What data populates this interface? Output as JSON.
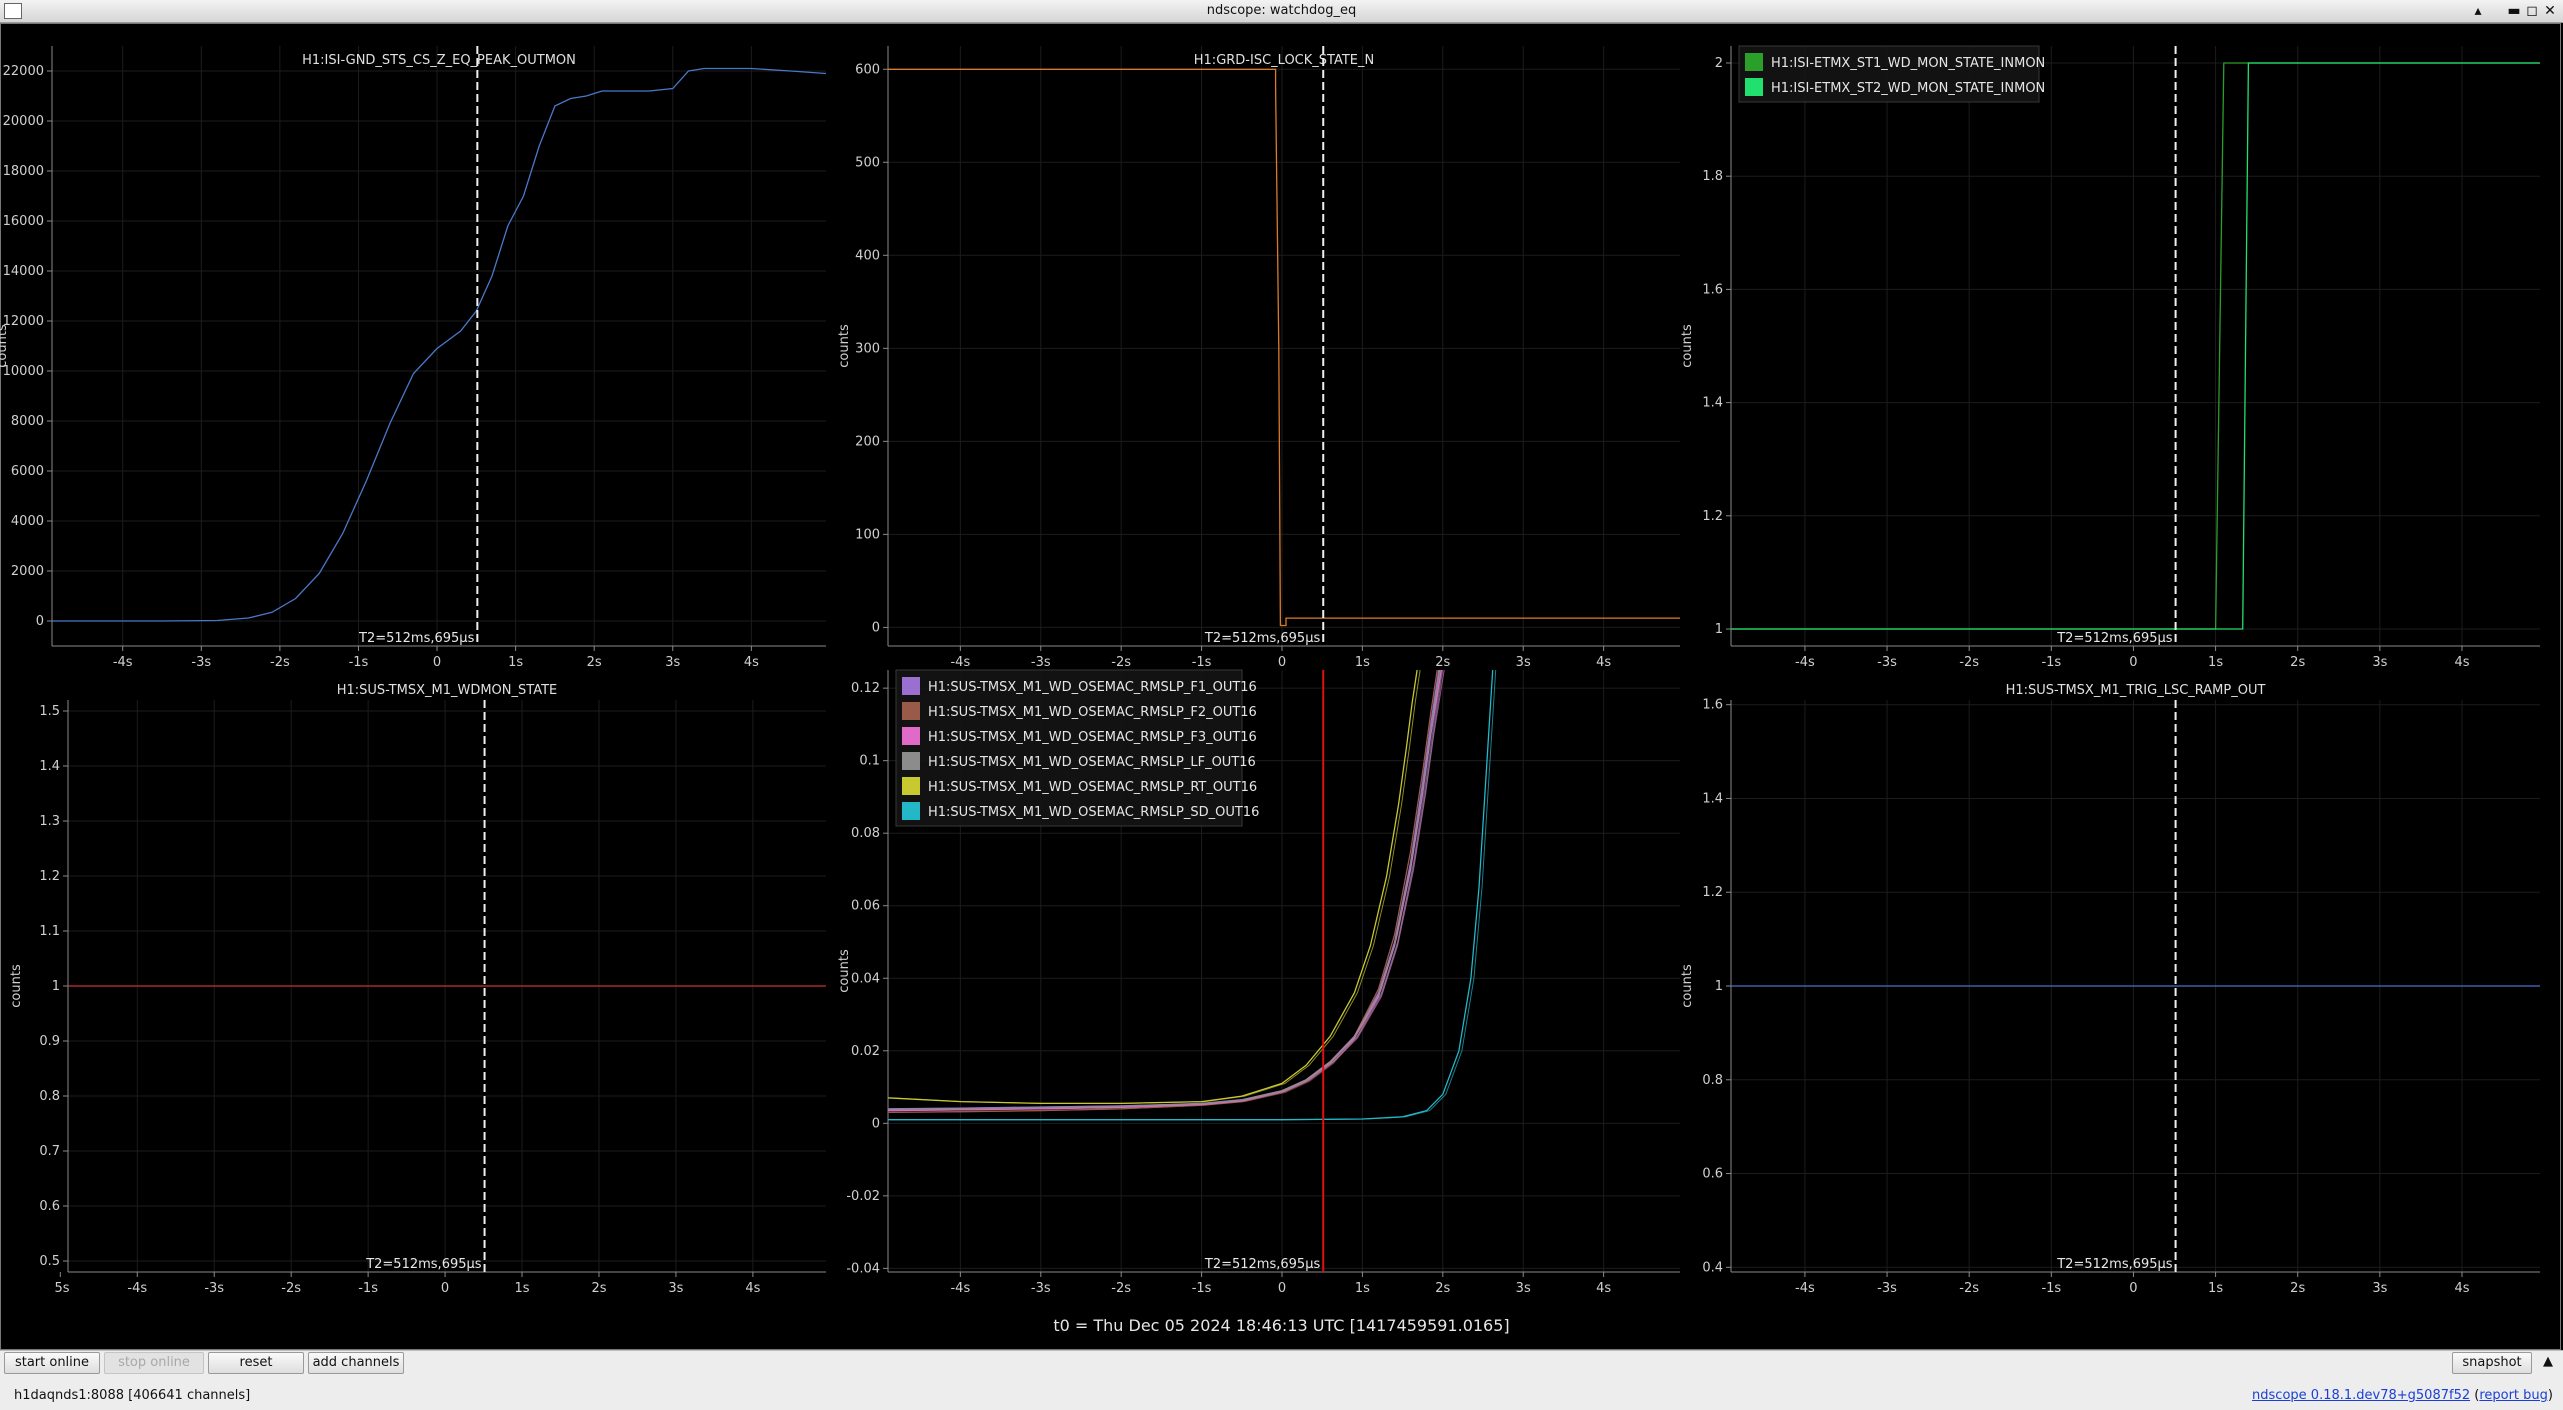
{
  "window": {
    "title": "ndscope: watchdog_eq",
    "minimize_glyph": "▴",
    "restore_glyph": "▬",
    "maximize_glyph": "◻",
    "close_glyph": "✕"
  },
  "t0_label": "t0 = Thu Dec 05 2024 18:46:13 UTC [1417459591.0165]",
  "cursor_label": "T2=512ms,695μs",
  "toolbar": {
    "start_online": "start online",
    "stop_online": "stop online",
    "reset": "reset",
    "add_channels": "add channels",
    "snapshot": "snapshot",
    "collapse_glyph": "▲"
  },
  "status": {
    "server": "h1daqnds1:8088",
    "channels": "[406641 channels]",
    "version": "ndscope 0.18.1.dev78+g5087f52",
    "report_bug": "report bug"
  },
  "chart_data": [
    {
      "type": "line",
      "title": "H1:ISI-GND_STS_CS_Z_EQ_PEAK_OUTMON",
      "ylabel": "counts",
      "xlim": [
        -4.9,
        4.95
      ],
      "ylim": [
        -1000,
        23000
      ],
      "xticks": [
        -4,
        -3,
        -2,
        -1,
        0,
        1,
        2,
        3,
        4
      ],
      "xtick_labels": [
        "-4s",
        "-3s",
        "-2s",
        "-1s",
        "0",
        "1s",
        "2s",
        "3s",
        "4s"
      ],
      "yticks": [
        0,
        2000,
        4000,
        6000,
        8000,
        10000,
        12000,
        14000,
        16000,
        18000,
        20000,
        22000
      ],
      "ytick_labels": [
        "0",
        "2000",
        "4000",
        "6000",
        "8000",
        "10000",
        "12000",
        "14000",
        "16000",
        "18000",
        "20000",
        "22000"
      ],
      "grid": true,
      "cursor_x": 0.513,
      "series": [
        {
          "color": "#4a78c8",
          "x": [
            -4.9,
            -3.5,
            -2.8,
            -2.4,
            -2.1,
            -1.8,
            -1.5,
            -1.2,
            -0.9,
            -0.6,
            -0.3,
            0,
            0.3,
            0.5,
            0.7,
            0.9,
            1.1,
            1.3,
            1.5,
            1.7,
            1.9,
            2.1,
            2.4,
            2.7,
            3.0,
            3.2,
            3.4,
            3.6,
            4.0,
            4.5,
            4.95
          ],
          "y": [
            0,
            0,
            20,
            120,
            350,
            900,
            1900,
            3500,
            5600,
            7900,
            9900,
            10900,
            11600,
            12400,
            13800,
            15800,
            17000,
            19000,
            20600,
            20900,
            21000,
            21200,
            21200,
            21200,
            21300,
            22000,
            22100,
            22100,
            22100,
            22000,
            21900
          ]
        }
      ]
    },
    {
      "type": "line",
      "title": "H1:GRD-ISC_LOCK_STATE_N",
      "ylabel": "counts",
      "xlim": [
        -4.9,
        4.95
      ],
      "ylim": [
        -20,
        625
      ],
      "xticks": [
        -4,
        -3,
        -2,
        -1,
        0,
        1,
        2,
        3,
        4
      ],
      "xtick_labels": [
        "-4s",
        "-3s",
        "-2s",
        "-1s",
        "0",
        "1s",
        "2s",
        "3s",
        "4s"
      ],
      "yticks": [
        0,
        100,
        200,
        300,
        400,
        500,
        600
      ],
      "ytick_labels": [
        "0",
        "100",
        "200",
        "300",
        "400",
        "500",
        "600"
      ],
      "grid": true,
      "cursor_x": 0.513,
      "series": [
        {
          "color": "#d97a2b",
          "x": [
            -4.9,
            -0.08,
            -0.08,
            -0.04,
            -0.02,
            0.05,
            0.05,
            0.2,
            4.95
          ],
          "y": [
            600,
            600,
            580,
            300,
            2,
            2,
            10,
            10,
            10
          ]
        }
      ]
    },
    {
      "type": "line",
      "xlim": [
        -4.9,
        4.95
      ],
      "ylim": [
        0.97,
        2.03
      ],
      "xticks": [
        -4,
        -3,
        -2,
        -1,
        0,
        1,
        2,
        3,
        4
      ],
      "xtick_labels": [
        "-4s",
        "-3s",
        "-2s",
        "-1s",
        "0",
        "1s",
        "2s",
        "3s",
        "4s"
      ],
      "yticks": [
        1,
        1.2,
        1.4,
        1.6,
        1.8,
        2
      ],
      "ytick_labels": [
        "1",
        "1.2",
        "1.4",
        "1.6",
        "1.8",
        "2"
      ],
      "ylabel": "counts",
      "grid": true,
      "cursor_x": 0.513,
      "legend": "top-left",
      "series": [
        {
          "name": "H1:ISI-ETMX_ST1_WD_MON_STATE_INMON",
          "color": "#2aa02a",
          "x": [
            -4.9,
            1.0,
            1.1,
            4.95
          ],
          "y": [
            1,
            1,
            2,
            2
          ]
        },
        {
          "name": "H1:ISI-ETMX_ST2_WD_MON_STATE_INMON",
          "color": "#22e070",
          "x": [
            -4.9,
            1.33,
            1.4,
            4.95
          ],
          "y": [
            1,
            1,
            2,
            2
          ]
        }
      ]
    },
    {
      "type": "line",
      "title": "H1:SUS-TMSX_M1_WDMON_STATE",
      "ylabel": "counts",
      "xlim": [
        -4.9,
        4.95
      ],
      "ylim": [
        0.48,
        1.52
      ],
      "xticks": [
        -5,
        -4,
        -3,
        -2,
        -1,
        0,
        1,
        2,
        3,
        4
      ],
      "xtick_labels": [
        "5s",
        "-4s",
        "-3s",
        "-2s",
        "-1s",
        "0",
        "1s",
        "2s",
        "3s",
        "4s"
      ],
      "yticks": [
        0.5,
        0.6,
        0.7,
        0.8,
        0.9,
        1,
        1.1,
        1.2,
        1.3,
        1.4,
        1.5
      ],
      "ytick_labels": [
        "0.5",
        "0.6",
        "0.7",
        "0.8",
        "0.9",
        "1",
        "1.1",
        "1.2",
        "1.3",
        "1.4",
        "1.5"
      ],
      "grid": true,
      "cursor_x": 0.513,
      "series": [
        {
          "color": "#c83232",
          "x": [
            -4.9,
            4.95
          ],
          "y": [
            1,
            1
          ]
        }
      ]
    },
    {
      "type": "line",
      "ylabel": "counts",
      "xlim": [
        -4.9,
        4.95
      ],
      "ylim": [
        -0.041,
        0.125
      ],
      "xticks": [
        -4,
        -3,
        -2,
        -1,
        0,
        1,
        2,
        3,
        4
      ],
      "xtick_labels": [
        "-4s",
        "-3s",
        "-2s",
        "-1s",
        "0",
        "1s",
        "2s",
        "3s",
        "4s"
      ],
      "yticks": [
        -0.04,
        -0.02,
        0,
        0.02,
        0.04,
        0.06,
        0.08,
        0.1,
        0.12
      ],
      "ytick_labels": [
        "-0.04",
        "-0.02",
        "0",
        "0.02",
        "0.04",
        "0.06",
        "0.08",
        "0.1",
        "0.12"
      ],
      "grid": true,
      "cursor_x": 0.513,
      "cursor_color": "#e01010",
      "legend": "top-left",
      "series": [
        {
          "name": "H1:SUS-TMSX_M1_WD_OSEMAC_RMSLP_F1_OUT16",
          "color": "#9b6fd0",
          "x": [
            -4.9,
            -4,
            -3,
            -2,
            -1,
            -0.5,
            0,
            0.3,
            0.6,
            0.9,
            1.2,
            1.4,
            1.6,
            1.75,
            1.85,
            1.95
          ],
          "y": [
            0.004,
            0.0042,
            0.0045,
            0.0048,
            0.0055,
            0.0065,
            0.009,
            0.012,
            0.017,
            0.024,
            0.036,
            0.05,
            0.072,
            0.094,
            0.11,
            0.125
          ]
        },
        {
          "name": "H1:SUS-TMSX_M1_WD_OSEMAC_RMSLP_F2_OUT16",
          "color": "#9a5a4a",
          "x": [
            -4.9,
            -4,
            -3,
            -2,
            -1,
            -0.5,
            0,
            0.3,
            0.6,
            0.9,
            1.2,
            1.4,
            1.6,
            1.75,
            1.85,
            1.93
          ],
          "y": [
            0.003,
            0.0032,
            0.0035,
            0.004,
            0.005,
            0.006,
            0.0085,
            0.0115,
            0.0165,
            0.024,
            0.037,
            0.052,
            0.075,
            0.097,
            0.113,
            0.125
          ]
        },
        {
          "name": "H1:SUS-TMSX_M1_WD_OSEMAC_RMSLP_F3_OUT16",
          "color": "#e06ac8",
          "x": [
            -4.9,
            -4,
            -3,
            -2,
            -1,
            -0.5,
            0,
            0.3,
            0.6,
            0.9,
            1.2,
            1.4,
            1.6,
            1.75,
            1.85,
            1.98
          ],
          "y": [
            0.0035,
            0.0037,
            0.004,
            0.0044,
            0.0052,
            0.0062,
            0.0088,
            0.0118,
            0.0168,
            0.0235,
            0.035,
            0.049,
            0.07,
            0.091,
            0.107,
            0.125
          ]
        },
        {
          "name": "H1:SUS-TMSX_M1_WD_OSEMAC_RMSLP_LF_OUT16",
          "color": "#8c8c8c",
          "x": [
            -4.9,
            -4,
            -3,
            -2,
            -1,
            -0.5,
            0,
            0.3,
            0.6,
            0.9,
            1.2,
            1.4,
            1.6,
            1.75,
            1.85,
            1.96
          ],
          "y": [
            0.0038,
            0.004,
            0.0043,
            0.0047,
            0.0054,
            0.0064,
            0.009,
            0.012,
            0.017,
            0.024,
            0.0355,
            0.0495,
            0.071,
            0.092,
            0.108,
            0.125
          ]
        },
        {
          "name": "H1:SUS-TMSX_M1_WD_OSEMAC_RMSLP_RT_OUT16",
          "color": "#c8c830",
          "x": [
            -4.9,
            -4,
            -3,
            -2,
            -1,
            -0.5,
            0,
            0.3,
            0.6,
            0.9,
            1.1,
            1.3,
            1.45,
            1.55,
            1.62,
            1.68
          ],
          "y": [
            0.007,
            0.006,
            0.0055,
            0.0055,
            0.006,
            0.0075,
            0.011,
            0.016,
            0.024,
            0.036,
            0.049,
            0.068,
            0.088,
            0.104,
            0.116,
            0.125
          ]
        },
        {
          "name": "H1:SUS-TMSX_M1_WD_OSEMAC_RMSLP_SD_OUT16",
          "color": "#22b8c8",
          "x": [
            -4.9,
            -4,
            -3,
            -2,
            -1,
            0,
            1,
            1.5,
            1.8,
            2.0,
            2.2,
            2.35,
            2.45,
            2.55,
            2.62
          ],
          "y": [
            0.001,
            0.001,
            0.001,
            0.001,
            0.001,
            0.001,
            0.0012,
            0.0018,
            0.0035,
            0.008,
            0.02,
            0.04,
            0.065,
            0.1,
            0.125
          ]
        }
      ]
    },
    {
      "type": "line",
      "title": "H1:SUS-TMSX_M1_TRIG_LSC_RAMP_OUT",
      "ylabel": "counts",
      "xlim": [
        -4.9,
        4.95
      ],
      "ylim": [
        0.39,
        1.61
      ],
      "xticks": [
        -4,
        -3,
        -2,
        -1,
        0,
        1,
        2,
        3,
        4
      ],
      "xtick_labels": [
        "-4s",
        "-3s",
        "-2s",
        "-1s",
        "0",
        "1s",
        "2s",
        "3s",
        "4s"
      ],
      "yticks": [
        0.4,
        0.6,
        0.8,
        1,
        1.2,
        1.4,
        1.6
      ],
      "ytick_labels": [
        "0.4",
        "0.6",
        "0.8",
        "1",
        "1.2",
        "1.4",
        "1.6"
      ],
      "grid": true,
      "cursor_x": 0.513,
      "series": [
        {
          "color": "#4a6fc8",
          "x": [
            -4.9,
            4.95
          ],
          "y": [
            1,
            1
          ]
        }
      ]
    }
  ]
}
